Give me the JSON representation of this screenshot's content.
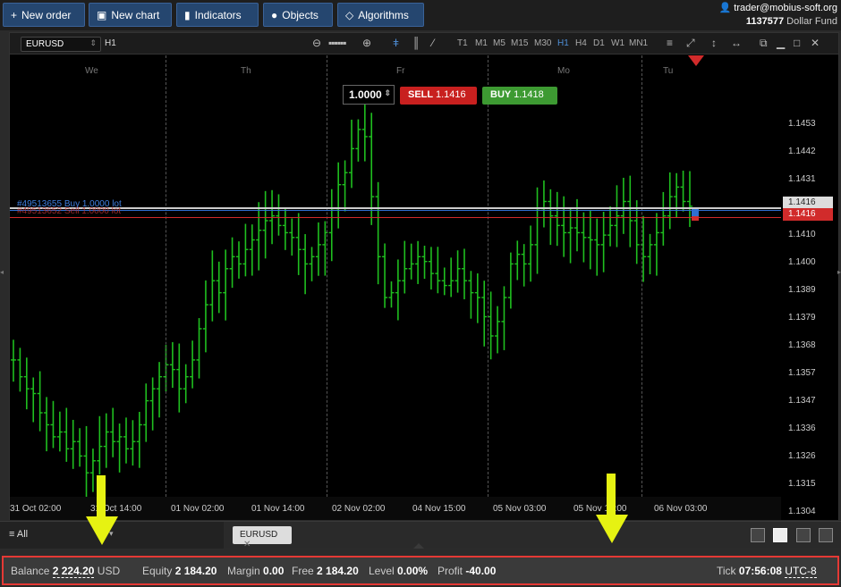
{
  "toolbar": {
    "new_order": "New order",
    "new_chart": "New chart",
    "indicators": "Indicators",
    "objects": "Objects",
    "algorithms": "Algorithms"
  },
  "user": {
    "email": "trader@mobius-soft.org",
    "account": "1137577",
    "fund": "Dollar Fund"
  },
  "chart": {
    "symbol": "EURUSD",
    "period": "H1",
    "timeframes": [
      "T1",
      "M1",
      "M5",
      "M15",
      "M30",
      "H1",
      "H4",
      "D1",
      "W1",
      "MN1"
    ],
    "active_timeframe": "H1",
    "quantity": "1.0000",
    "sell_label": "SELL",
    "sell_price": "1.1416",
    "buy_label": "BUY",
    "buy_price": "1.1418",
    "order_line_buy": "#49513655 Buy 1.0000 lot",
    "order_line_sell": "#49513652 Sell 1.0000 lot",
    "current_price_tag": "1.1416",
    "sell_price_tag": "1.1416"
  },
  "chart_data": {
    "type": "ohlc",
    "yticks": [
      "1.1453",
      "1.1442",
      "1.1431",
      "1.1421",
      "1.1410",
      "1.1400",
      "1.1389",
      "1.1379",
      "1.1368",
      "1.1357",
      "1.1347",
      "1.1336",
      "1.1326",
      "1.1315",
      "1.1304"
    ],
    "xticks": [
      "31 Oct 02:00",
      "31 Oct 14:00",
      "01 Nov 02:00",
      "01 Nov 14:00",
      "02 Nov 02:00",
      "04 Nov 15:00",
      "05 Nov 03:00",
      "05 Nov 15:00",
      "06 Nov 03:00"
    ],
    "day_labels": [
      "We",
      "Th",
      "Fr",
      "Mo",
      "Tu"
    ],
    "ylim": [
      1.1298,
      1.1458
    ],
    "bars": [
      1.1352,
      1.1345,
      1.134,
      1.1338,
      1.133,
      1.1325,
      1.132,
      1.1322,
      1.1315,
      1.1318,
      1.1312,
      1.1305,
      1.131,
      1.1316,
      1.1322,
      1.1318,
      1.132,
      1.1315,
      1.1318,
      1.1325,
      1.1335,
      1.134,
      1.1345,
      1.135,
      1.1348,
      1.134,
      1.1345,
      1.1352,
      1.1365,
      1.1375,
      1.1385,
      1.138,
      1.139,
      1.1395,
      1.1392,
      1.1398,
      1.1402,
      1.1406,
      1.141,
      1.1412,
      1.1408,
      1.1405,
      1.1403,
      1.1398,
      1.1392,
      1.1395,
      1.14,
      1.1405,
      1.1415,
      1.1425,
      1.143,
      1.144,
      1.1448,
      1.1445,
      1.142,
      1.1395,
      1.1378,
      1.138,
      1.1385,
      1.139,
      1.1392,
      1.1395,
      1.1393,
      1.1388,
      1.1385,
      1.1383,
      1.1385,
      1.139,
      1.1385,
      1.138,
      1.1378,
      1.137,
      1.1362,
      1.1368,
      1.1378,
      1.1392,
      1.1396,
      1.1392,
      1.14,
      1.1415,
      1.1418,
      1.1412,
      1.1408,
      1.1405,
      1.1407,
      1.1405,
      1.1403,
      1.1402,
      1.14,
      1.1404,
      1.1408,
      1.1412,
      1.1418,
      1.141,
      1.14,
      1.1395,
      1.14,
      1.1405,
      1.1412,
      1.142,
      1.1424,
      1.1418,
      1.1416
    ],
    "ohlc": null
  },
  "tabs": {
    "all_label": "All",
    "symbol_tab": "EURUSD"
  },
  "status": {
    "balance_label": "Balance",
    "balance_value": "2 224.20",
    "balance_currency": "USD",
    "equity_label": "Equity",
    "equity_value": "2 184.20",
    "margin_label": "Margin",
    "margin_value": "0.00",
    "free_label": "Free",
    "free_value": "2 184.20",
    "level_label": "Level",
    "level_value": "0.00%",
    "profit_label": "Profit",
    "profit_value": "-40.00",
    "tick_label": "Tick",
    "tick_value": "07:56:08",
    "timezone": "UTC-8"
  },
  "colors": {
    "accent": "#25466f",
    "sell": "#c8201f",
    "buy": "#3d9a32",
    "candle": "#1fbf1f",
    "highlight": "#e53935"
  }
}
